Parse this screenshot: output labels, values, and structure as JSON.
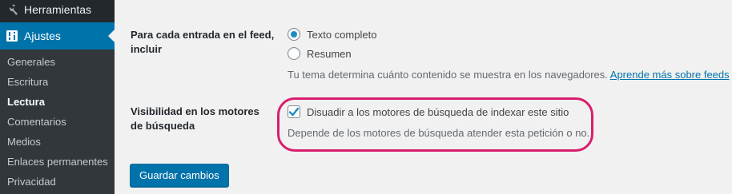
{
  "sidebar": {
    "tools_label": "Herramientas",
    "settings_label": "Ajustes",
    "submenu": [
      {
        "label": "Generales"
      },
      {
        "label": "Escritura"
      },
      {
        "label": "Lectura"
      },
      {
        "label": "Comentarios"
      },
      {
        "label": "Medios"
      },
      {
        "label": "Enlaces permanentes"
      },
      {
        "label": "Privacidad"
      }
    ],
    "current_item": "Lectura"
  },
  "feed": {
    "label": "Para cada entrada en el feed, incluir",
    "options": [
      {
        "label": "Texto completo",
        "checked": true
      },
      {
        "label": "Resumen",
        "checked": false
      }
    ],
    "description": "Tu tema determina cuánto contenido se muestra en los navegadores.",
    "link_text": "Aprende más sobre feeds"
  },
  "visibility": {
    "label": "Visibilidad en los motores de búsqueda",
    "checkbox_label": "Disuadir a los motores de búsqueda de indexar este sitio",
    "checked": true,
    "description": "Depende de los motores de búsqueda atender esta petición o no."
  },
  "save_button_label": "Guardar cambios",
  "colors": {
    "accent": "#0073aa",
    "highlight": "#d81e6c",
    "sidebar_bg": "#23282d",
    "submenu_bg": "#32373c"
  }
}
